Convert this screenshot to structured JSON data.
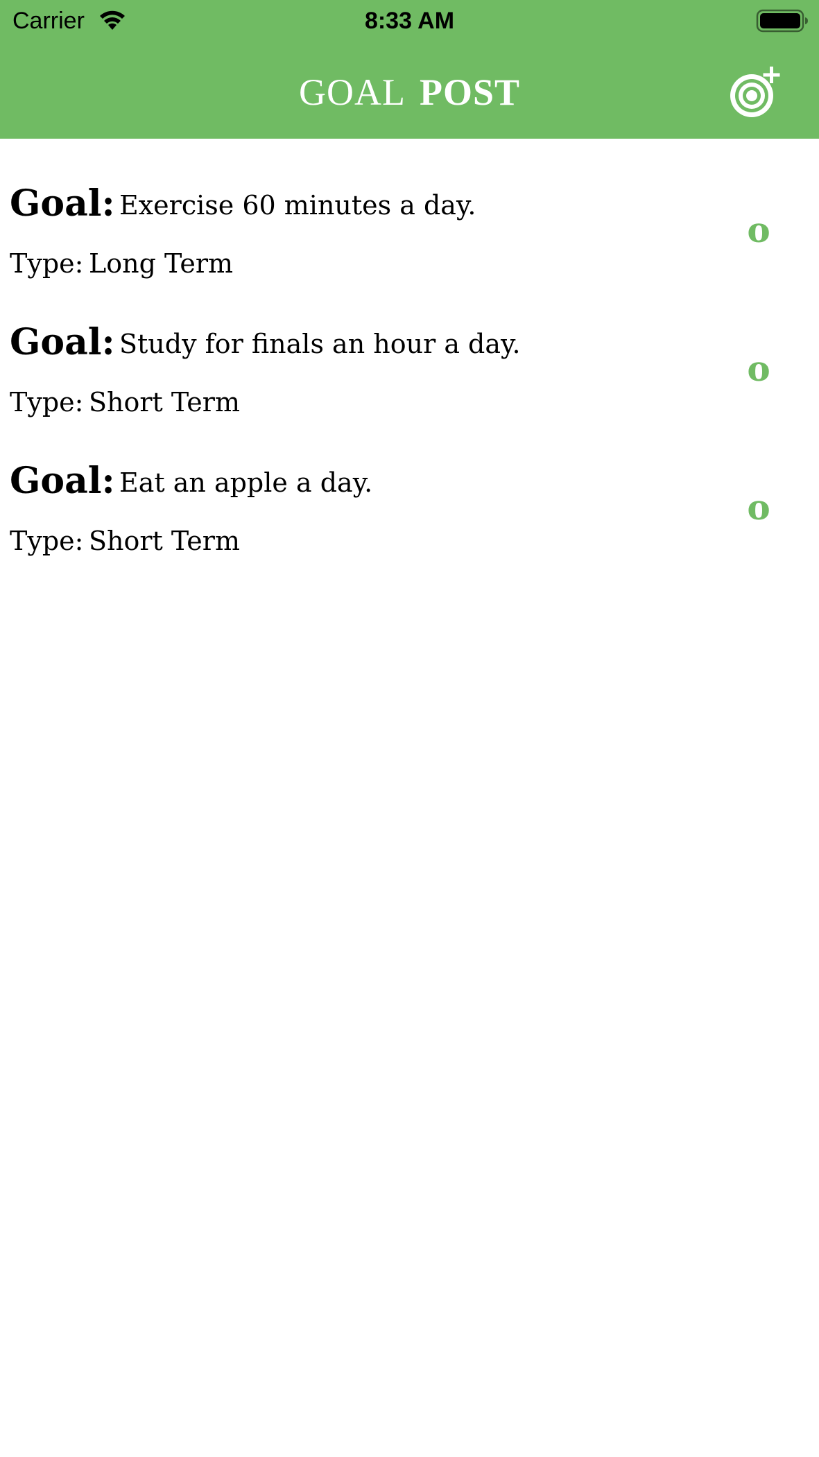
{
  "status_bar": {
    "carrier": "Carrier",
    "time": "8:33 AM",
    "wifi_icon": "wifi-icon",
    "battery_icon": "battery-full-icon"
  },
  "nav": {
    "title_part1": "GOAL",
    "title_part2": "POST",
    "add_button_icon": "target-plus-icon",
    "background_color": "#70bb63",
    "title_color": "#ffffff"
  },
  "goal_label": "Goal:",
  "type_label": "Type:",
  "goals": [
    {
      "text": "Exercise 60 minutes a day.",
      "type": "Long Term",
      "complete_mark": "o"
    },
    {
      "text": "Study for finals an hour a day.",
      "type": "Short Term",
      "complete_mark": "o"
    },
    {
      "text": "Eat an apple a day.",
      "type": "Short Term",
      "complete_mark": "o"
    }
  ],
  "accent_color": "#70bb63"
}
